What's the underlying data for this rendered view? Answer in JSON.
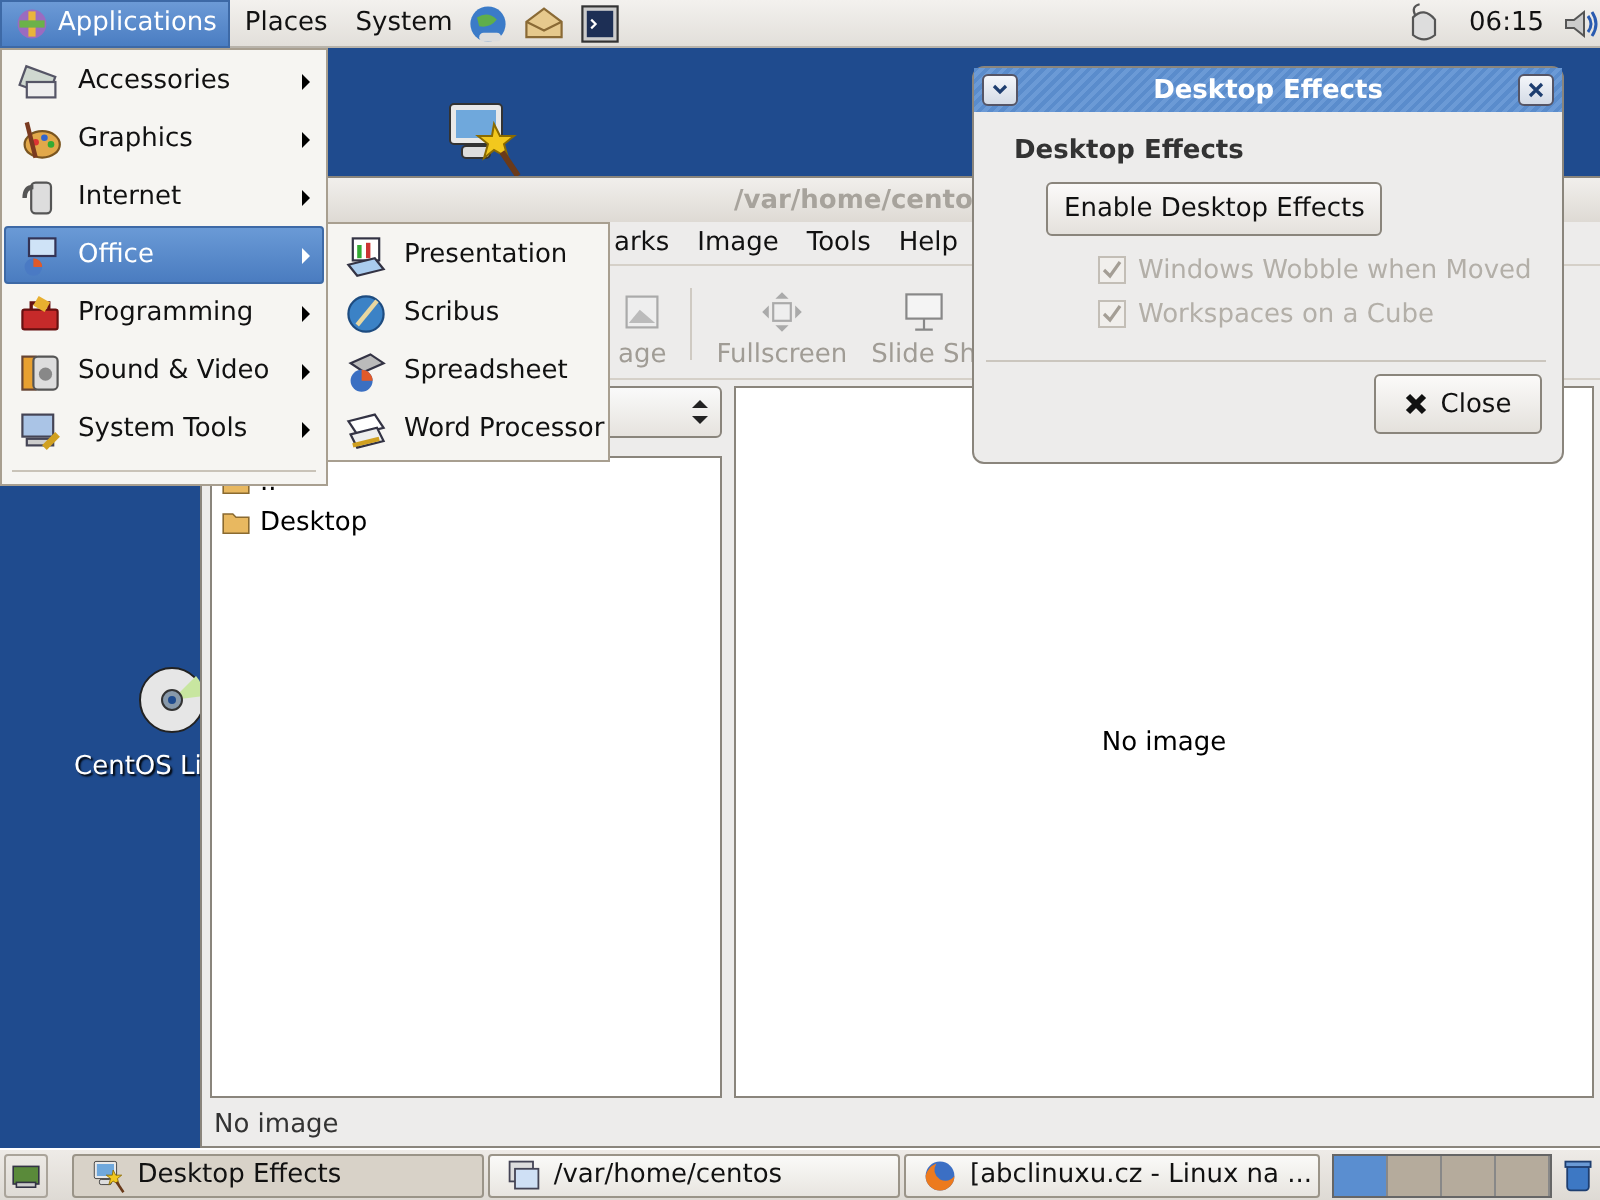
{
  "top_panel": {
    "menus": [
      {
        "label": "Applications",
        "selected": true
      },
      {
        "label": "Places",
        "selected": false
      },
      {
        "label": "System",
        "selected": false
      }
    ],
    "clock": "06:15"
  },
  "applications_menu": {
    "items": [
      {
        "label": "Accessories",
        "selected": false
      },
      {
        "label": "Graphics",
        "selected": false
      },
      {
        "label": "Internet",
        "selected": false
      },
      {
        "label": "Office",
        "selected": true
      },
      {
        "label": "Programming",
        "selected": false
      },
      {
        "label": "Sound & Video",
        "selected": false
      },
      {
        "label": "System Tools",
        "selected": false
      }
    ]
  },
  "office_submenu": {
    "items": [
      "Presentation",
      "Scribus",
      "Spreadsheet",
      "Word Processor"
    ]
  },
  "desktop_icons": [
    {
      "label": "CentOS Li"
    }
  ],
  "image_viewer": {
    "title": "/var/home/cento",
    "menus": [
      "arks",
      "Image",
      "Tools",
      "Help"
    ],
    "toolbar": [
      "age",
      "Fullscreen",
      "Slide Sh"
    ],
    "files": [
      "..",
      "Desktop"
    ],
    "image_pane": "No image",
    "status": "No image"
  },
  "dialog": {
    "title": "Desktop Effects",
    "heading": "Desktop Effects",
    "enable_button": "Enable Desktop Effects",
    "options": [
      {
        "label": "Windows Wobble when Moved",
        "checked": true,
        "disabled": true
      },
      {
        "label": "Workspaces on a Cube",
        "checked": true,
        "disabled": true
      }
    ],
    "close_button": "Close"
  },
  "taskbar": {
    "tasks": [
      {
        "label": "Desktop Effects",
        "selected": true
      },
      {
        "label": "/var/home/centos",
        "selected": false
      },
      {
        "label": "[abclinuxu.cz - Linux na ...",
        "selected": false
      }
    ],
    "workspaces": [
      {
        "selected": true
      },
      {
        "selected": false
      },
      {
        "selected": false
      },
      {
        "selected": false
      }
    ]
  }
}
